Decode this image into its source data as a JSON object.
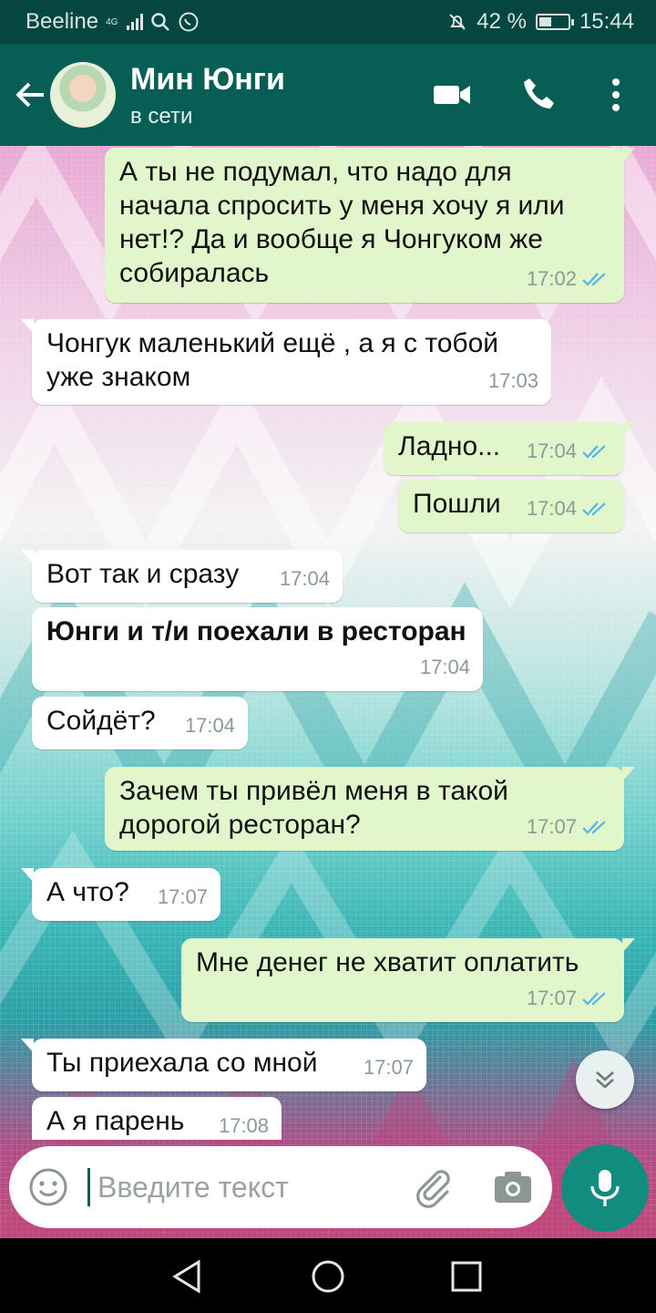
{
  "status_bar": {
    "carrier": "Beeline",
    "network": "4G",
    "battery": "42 %",
    "battery_level": 0.42,
    "time": "15:44"
  },
  "header": {
    "contact_name": "Мин Юнги",
    "status": "в сети",
    "icons": [
      "back-arrow-icon",
      "avatar",
      "video-call-icon",
      "phone-icon",
      "more-vert-icon"
    ]
  },
  "messages": [
    {
      "dir": "out",
      "text": "А ты не подумал, что надо для\nначала спросить у меня хочу я или\nнет!? Да и вообще я Чонгуком же\nсобиралась",
      "time": "17:02",
      "read": true
    },
    {
      "dir": "in",
      "text": "Чонгук маленький ещё , а я с тобой\nуже знаком",
      "time": "17:03"
    },
    {
      "dir": "out",
      "text": "Ладно...",
      "time": "17:04",
      "read": true
    },
    {
      "dir": "out",
      "text": "Пошли",
      "time": "17:04",
      "read": true
    },
    {
      "dir": "in",
      "text": "Вот так и сразу",
      "time": "17:04"
    },
    {
      "dir": "in",
      "text": "Юнги и т/и поехали в ресторан",
      "time": "17:04",
      "bold": true
    },
    {
      "dir": "in",
      "text": "Сойдёт?",
      "time": "17:04"
    },
    {
      "dir": "out",
      "text": "Зачем ты привёл меня в такой\nдорогой ресторан?",
      "time": "17:07",
      "read": true
    },
    {
      "dir": "in",
      "text": "А что?",
      "time": "17:07"
    },
    {
      "dir": "out",
      "text": "Мне денег не хватит оплатить",
      "time": "17:07",
      "read": true
    },
    {
      "dir": "in",
      "text": "Ты приехала со мной",
      "time": "17:07"
    },
    {
      "dir": "in",
      "text": "А я парень",
      "time": "17:08"
    }
  ],
  "input": {
    "placeholder": "Введите текст"
  },
  "colors": {
    "header": "#075e54",
    "status_bar": "#054640",
    "outgoing_bubble": "#e1f7cb",
    "incoming_bubble": "#ffffff",
    "read_ticks": "#4fb5ec",
    "mic_button": "#128c7e"
  }
}
